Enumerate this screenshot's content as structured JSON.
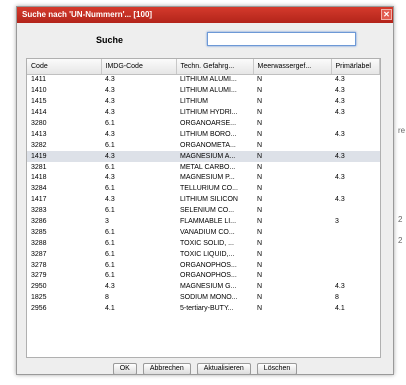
{
  "dialog": {
    "title": "Suche nach 'UN-Nummern'... [100]",
    "close_glyph": "✕"
  },
  "search": {
    "label": "Suche",
    "value": ""
  },
  "table": {
    "columns": [
      "Code",
      "IMDG-Code",
      "Techn. Gefahrg...",
      "Meerwassergef...",
      "Primärlabel"
    ],
    "selected_row_index": 7,
    "rows": [
      [
        "1411",
        "4.3",
        "LITHIUM ALUMI...",
        "N",
        "4.3"
      ],
      [
        "1410",
        "4.3",
        "LITHIUM ALUMI...",
        "N",
        "4.3"
      ],
      [
        "1415",
        "4.3",
        "LITHIUM",
        "N",
        "4.3"
      ],
      [
        "1414",
        "4.3",
        "LITHIUM HYDRI...",
        "N",
        "4.3"
      ],
      [
        "3280",
        "6.1",
        "ORGANOARSE...",
        "N",
        ""
      ],
      [
        "1413",
        "4.3",
        "LITHIUM BORO...",
        "N",
        "4.3"
      ],
      [
        "3282",
        "6.1",
        "ORGANOMETA...",
        "N",
        ""
      ],
      [
        "1419",
        "4.3",
        "MAGNESIUM A...",
        "N",
        "4.3"
      ],
      [
        "3281",
        "6.1",
        "METAL CARBO...",
        "N",
        ""
      ],
      [
        "1418",
        "4.3",
        "MAGNESIUM P...",
        "N",
        "4.3"
      ],
      [
        "3284",
        "6.1",
        "TELLURIUM CO...",
        "N",
        ""
      ],
      [
        "1417",
        "4.3",
        "LITHIUM SILICON",
        "N",
        "4.3"
      ],
      [
        "3283",
        "6.1",
        "SELENIUM CO...",
        "N",
        ""
      ],
      [
        "3286",
        "3",
        "FLAMMABLE LI...",
        "N",
        "3"
      ],
      [
        "3285",
        "6.1",
        "VANADIUM CO...",
        "N",
        ""
      ],
      [
        "3288",
        "6.1",
        "TOXIC SOLID, ...",
        "N",
        ""
      ],
      [
        "3287",
        "6.1",
        "TOXIC LIQUID,...",
        "N",
        ""
      ],
      [
        "3278",
        "6.1",
        "ORGANOPHOS...",
        "N",
        ""
      ],
      [
        "3279",
        "6.1",
        "ORGANOPHOS...",
        "N",
        ""
      ],
      [
        "2950",
        "4.3",
        "MAGNESIUM G...",
        "N",
        "4.3"
      ],
      [
        "1825",
        "8",
        "SODIUM MONO...",
        "N",
        "8"
      ],
      [
        "2956",
        "4.1",
        "5-tertiary-BUTY...",
        "N",
        "4.1"
      ]
    ]
  },
  "buttons": {
    "ok": "OK",
    "cancel": "Abbrechen",
    "refresh": "Aktualisieren",
    "delete": "Löschen"
  },
  "background": {
    "stub_1": "re",
    "stub_2": "2",
    "stub_3": "2"
  },
  "colors": {
    "titlebar": "#c4302a",
    "selected_row": "#dde1e8",
    "input_focus": "#6d99d6"
  }
}
